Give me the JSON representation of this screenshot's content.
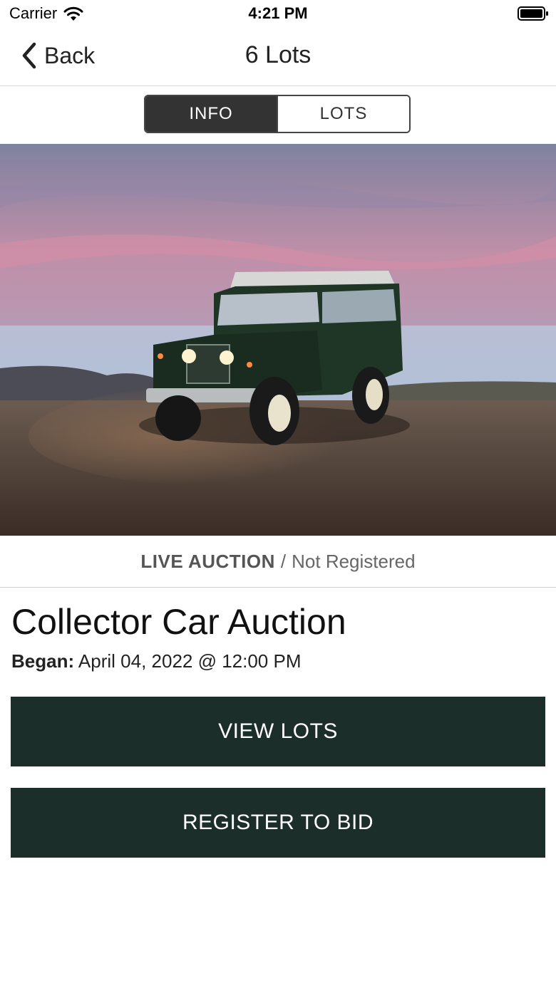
{
  "status_bar": {
    "carrier": "Carrier",
    "time": "4:21 PM",
    "icons": [
      "wifi-icon",
      "battery-icon"
    ]
  },
  "nav": {
    "back_label": "Back",
    "title": "6 Lots",
    "icons": [
      "chevron-left-icon"
    ]
  },
  "segments": [
    {
      "label": "INFO",
      "selected": true
    },
    {
      "label": "LOTS",
      "selected": false
    }
  ],
  "hero_image": {
    "subject": "green vintage off-road vehicle parked on a hilltop at dusk above the clouds"
  },
  "auction_status": {
    "type": "LIVE AUCTION",
    "separator": "/",
    "registration": "Not Registered"
  },
  "auction": {
    "title": "Collector Car Auction",
    "began_label": "Began:",
    "began_value": "April 04, 2022 @ 12:00 PM"
  },
  "buttons": {
    "view_lots": "VIEW LOTS",
    "register": "REGISTER TO BID"
  },
  "colors": {
    "button_bg": "#1b2e29",
    "segment_active_bg": "#333333",
    "text_muted": "#666666"
  }
}
